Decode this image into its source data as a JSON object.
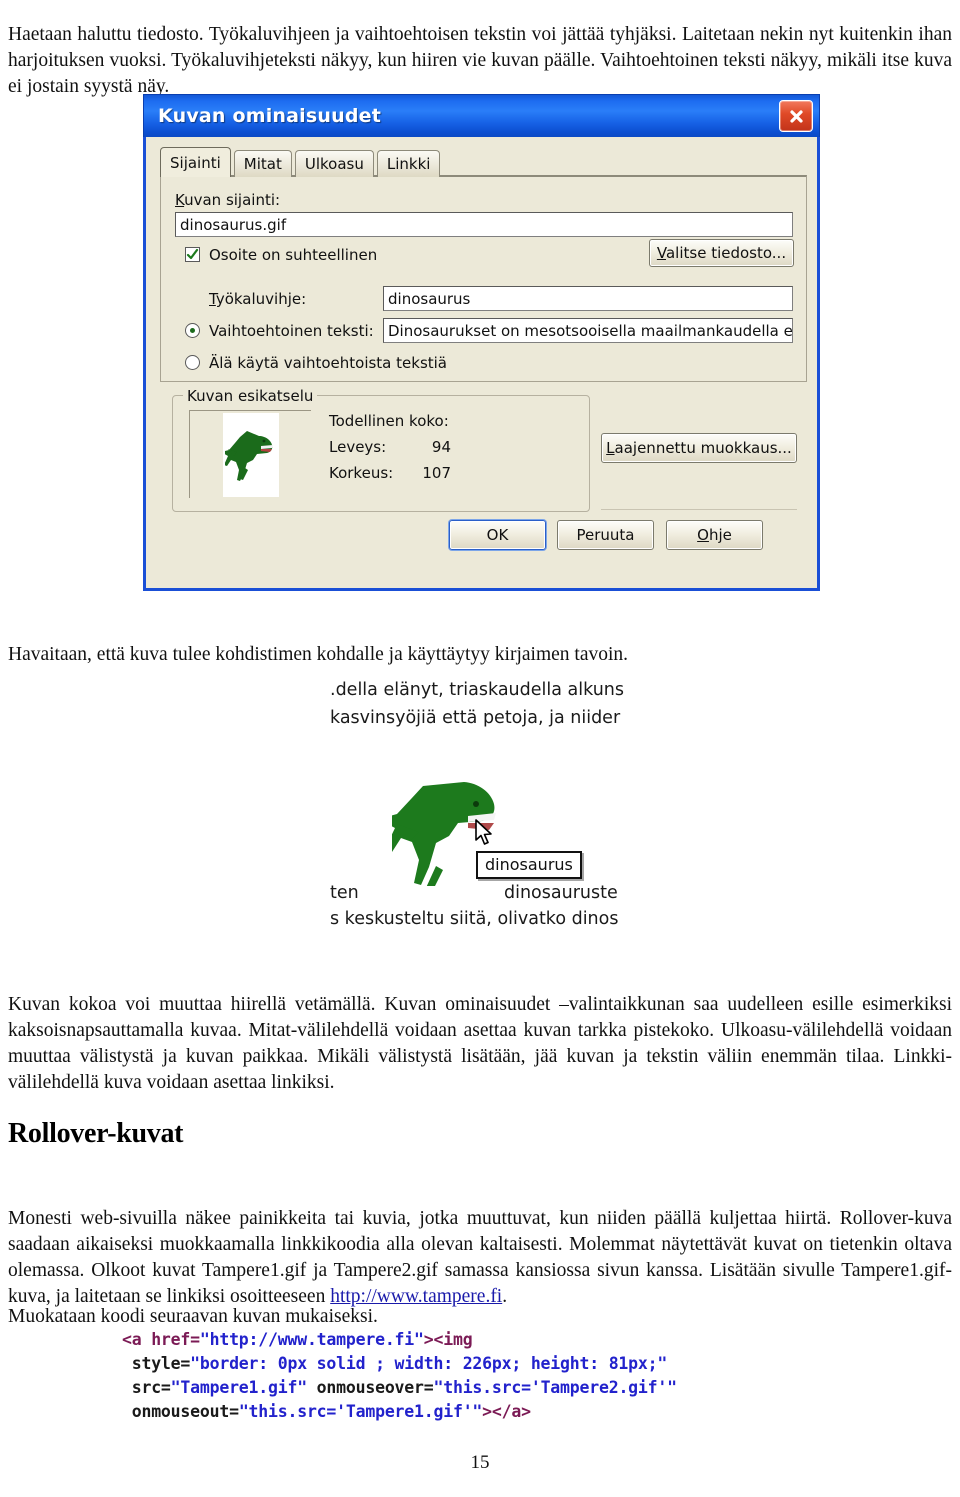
{
  "document": {
    "page_number": "15",
    "paragraphs": {
      "intro": "Haetaan haluttu tiedosto. Työkaluvihjeen ja vaihtoehtoisen tekstin voi jättää tyhjäksi. Laitetaan nekin nyt kuitenkin ihan harjoituksen vuoksi. Työkaluvihjeteksti näkyy, kun hiiren vie kuvan päälle. Vaihtoehtoinen teksti näkyy, mikäli itse kuva ei jostain syystä näy.",
      "after_dialog": "Havaitaan, että kuva tulee kohdistimen kohdalle ja käyttäytyy kirjaimen tavoin.",
      "after_screenshot": "Kuvan kokoa voi muuttaa hiirellä vetämällä. Kuvan ominaisuudet –valintaikkunan saa uudelleen esille esimerkiksi kaksoisnapsauttamalla kuvaa. Mitat-välilehdellä voidaan asettaa kuvan tarkka pistekoko. Ulkoasu-välilehdellä voidaan muuttaa välistystä ja kuvan paikkaa. Mikäli välistystä lisätään, jää kuvan ja tekstin väliin enemmän tilaa. Linkki-välilehdellä kuva voidaan asettaa linkiksi.",
      "rollover_a": "Monesti web-sivuilla näkee painikkeita tai kuvia, jotka muuttuvat, kun niiden päällä kuljettaa hiirtä. Rollover-kuva saadaan aikaiseksi muokkaamalla linkkikoodia alla olevan kaltaisesti. Molemmat näytettävät kuvat on tietenkin oltava olemassa. Olkoot kuvat Tampere1.gif ja Tampere2.gif samassa kansiossa sivun kanssa. Lisätään sivulle Tampere1.gif-kuva, ja laitetaan se linkiksi osoitteeseen ",
      "rollover_link": "http://www.tampere.fi",
      "rollover_b": ".",
      "last": "Muokataan koodi seuraavan kuvan mukaiseksi."
    },
    "section_title": "Rollover-kuvat"
  },
  "dialog": {
    "title": "Kuvan ominaisuudet",
    "close_icon": "close-icon",
    "tabs": [
      {
        "label": "Sijainti",
        "active": true
      },
      {
        "label": "Mitat",
        "active": false
      },
      {
        "label": "Ulkoasu",
        "active": false
      },
      {
        "label": "Linkki",
        "active": false
      }
    ],
    "fields": {
      "location_label": "Kuvan sijainti:",
      "location_value": "dinosaurus.gif",
      "relative_checkbox_label": "Osoite on suhteellinen",
      "relative_checkbox_checked": true,
      "choose_file_button": "Valitse tiedosto...",
      "tooltip_label": "Työkaluvihje:",
      "tooltip_value": "dinosaurus",
      "alt_radio_label": "Vaihtoehtoinen teksti:",
      "alt_radio_selected": true,
      "alt_value": "Dinosaurukset on mesotsooisella maailmankaudella elänyt",
      "no_alt_radio_label": "Älä käytä vaihtoehtoista tekstiä",
      "no_alt_radio_selected": false
    },
    "preview": {
      "group_label": "Kuvan esikatselu",
      "real_size_label": "Todellinen koko:",
      "width_label": "Leveys:",
      "width_value": "94",
      "height_label": "Korkeus:",
      "height_value": "107",
      "advanced_button": "Laajennettu muokkaus..."
    },
    "buttons": {
      "ok": "OK",
      "cancel": "Peruuta",
      "help": "Ohje"
    },
    "colors": {
      "titlebar_blue": "#1d6cf0",
      "dialog_face": "#ece9d8",
      "close_red": "#e04a27",
      "border_blue": "#1a4fd6"
    }
  },
  "screenshot2": {
    "text_line_1": ".della elänyt, triaskaudella alkuns",
    "text_line_2": "kasvinsyöjiä että petoja, ja niider",
    "text_line_3": "ten",
    "text_line_4": "dinosauruste",
    "text_line_5": "s keskusteltu siitä, olivatko dinos",
    "tooltip_text": "dinosaurus",
    "cursor_icon": "mouse-pointer-icon"
  },
  "code_sample": {
    "lines": [
      [
        {
          "t": "<a ",
          "c": "tag"
        },
        {
          "t": "href=",
          "c": "attr"
        },
        {
          "t": "\"http://www.tampere.fi\"",
          "c": "val"
        },
        {
          "t": "><img",
          "c": "tag"
        }
      ],
      [
        {
          "t": " style=",
          "c": "plain"
        },
        {
          "t": "\"border: 0px solid ; width: 226px; height: 81px;\"",
          "c": "val"
        }
      ],
      [
        {
          "t": " src=",
          "c": "plain"
        },
        {
          "t": "\"Tampere1.gif\"",
          "c": "val"
        },
        {
          "t": " onmouseover=",
          "c": "plain"
        },
        {
          "t": "\"this.src='Tampere2.gif'\"",
          "c": "val"
        }
      ],
      [
        {
          "t": " onmouseout=",
          "c": "plain"
        },
        {
          "t": "\"this.src='Tampere1.gif'\"",
          "c": "val"
        },
        {
          "t": "></a>",
          "c": "tag"
        }
      ]
    ]
  }
}
